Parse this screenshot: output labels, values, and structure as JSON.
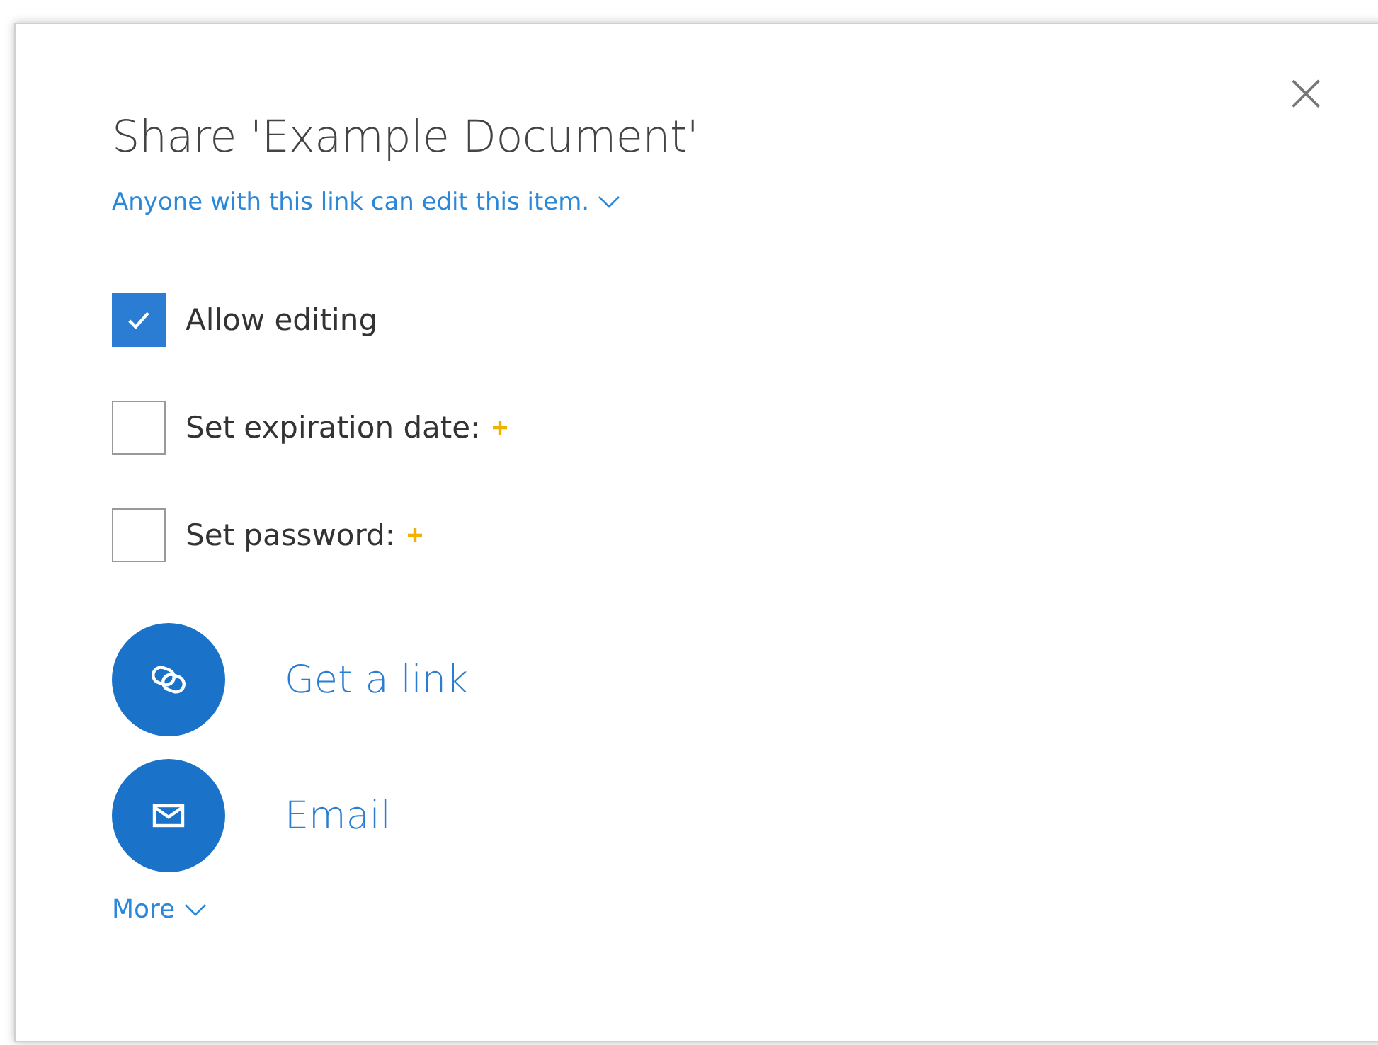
{
  "dialog": {
    "title": "Share 'Example Document'",
    "close": "×",
    "permission": {
      "label": "Anyone with this link can edit this item."
    },
    "options": [
      {
        "label": "Allow editing",
        "checked": true,
        "plus": false
      },
      {
        "label": "Set expiration date:",
        "checked": false,
        "plus": true
      },
      {
        "label": "Set password:",
        "checked": false,
        "plus": true
      }
    ],
    "actions": [
      {
        "kind": "link",
        "label": "Get a link"
      },
      {
        "kind": "email",
        "label": "Email"
      }
    ],
    "more": {
      "label": "More"
    }
  }
}
